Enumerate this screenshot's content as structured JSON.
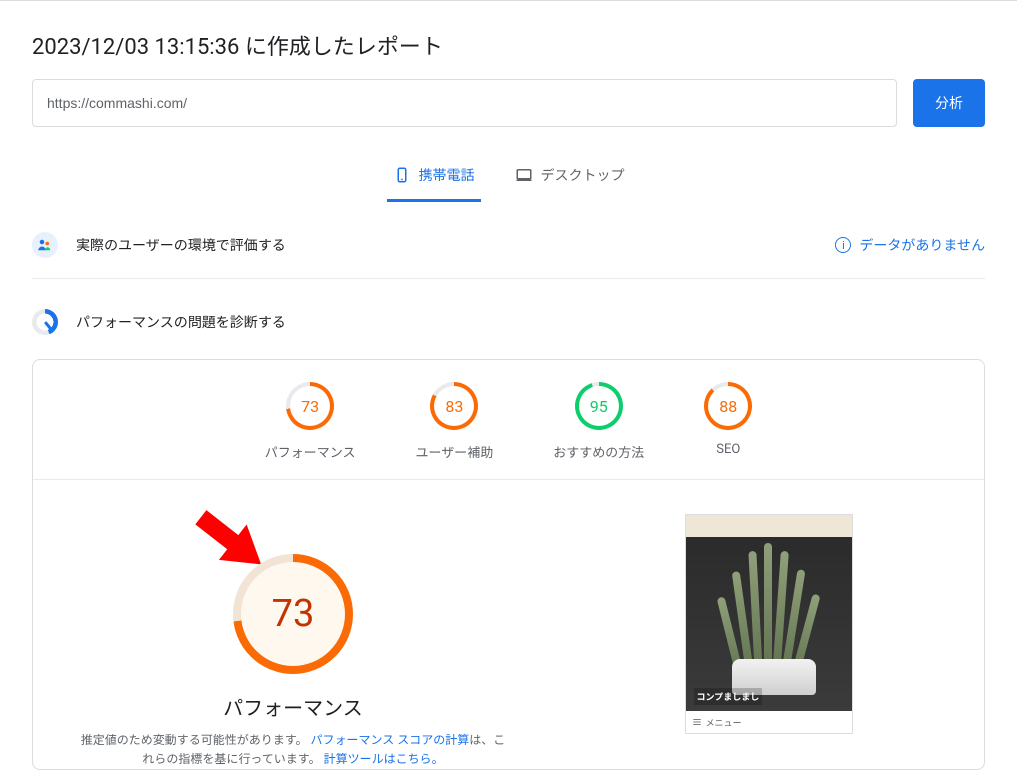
{
  "page": {
    "title": "2023/12/03 13:15:36 に作成したレポート",
    "url_value": "https://commashi.com/",
    "analyze_label": "分析"
  },
  "tabs": {
    "mobile": "携帯電話",
    "desktop": "デスクトップ"
  },
  "sections": {
    "real_user": "実際のユーザーの環境で評価する",
    "no_data": "データがありません",
    "diagnose": "パフォーマンスの問題を診断する"
  },
  "gauges": [
    {
      "score": "73",
      "label": "パフォーマンス",
      "color": "#fa6b05",
      "bg": "#fff",
      "pct": 73
    },
    {
      "score": "83",
      "label": "ユーザー補助",
      "color": "#fa6b05",
      "bg": "#fff",
      "pct": 83
    },
    {
      "score": "95",
      "label": "おすすめの方法",
      "color": "#0cce6b",
      "bg": "#fff",
      "pct": 95
    },
    {
      "score": "88",
      "label": "SEO",
      "color": "#fa6b05",
      "bg": "#fff",
      "pct": 88
    }
  ],
  "performance": {
    "score": "73",
    "heading": "パフォーマンス",
    "desc_pre": "推定値のため変動する可能性があります。",
    "desc_link1": "パフォーマンス スコアの計算",
    "desc_mid": "は、これらの指標を基に行っています。",
    "desc_link2": "計算ツールはこちら。",
    "color": "#fa6b05",
    "pct": 73
  },
  "screenshot": {
    "caption": "コンプましまし",
    "menu": "メニュー"
  }
}
